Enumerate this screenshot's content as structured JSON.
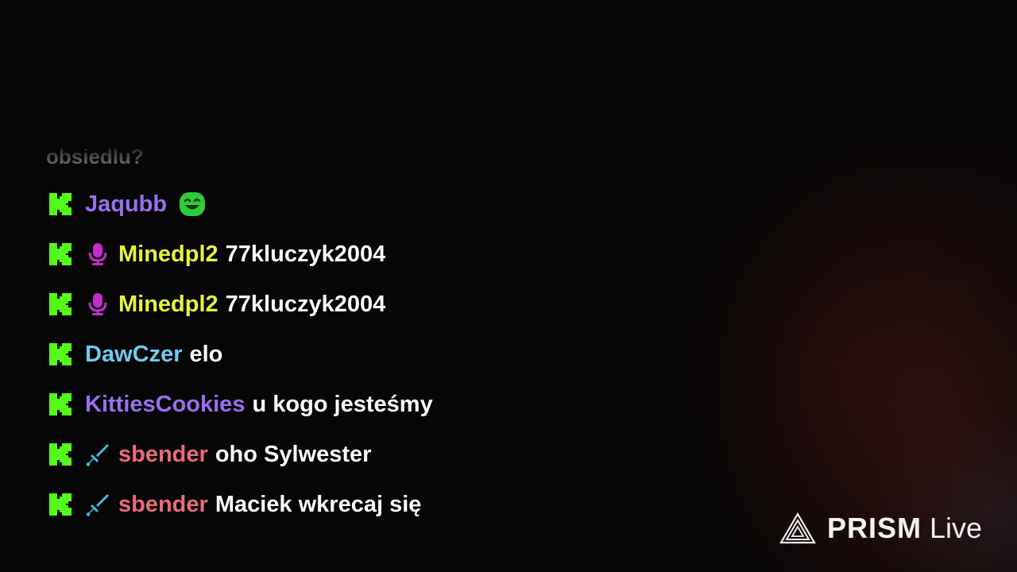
{
  "chat": {
    "cutoff_text": "obsiedlu?",
    "messages": [
      {
        "platform_icon": "kick-logo-icon",
        "badge": null,
        "username": "Jaqubb",
        "user_color": "#9b6ff0",
        "text": "",
        "emote": "grin-emote-icon"
      },
      {
        "platform_icon": "kick-logo-icon",
        "badge": "microphone-icon",
        "badge_color": "#c02fc9",
        "username": "Minedpl2",
        "user_color": "#e5f53a",
        "text": "77kluczyk2004"
      },
      {
        "platform_icon": "kick-logo-icon",
        "badge": "microphone-icon",
        "badge_color": "#c02fc9",
        "username": "Minedpl2",
        "user_color": "#e5f53a",
        "text": "77kluczyk2004"
      },
      {
        "platform_icon": "kick-logo-icon",
        "badge": null,
        "username": "DawCzer",
        "user_color": "#6ecbf0",
        "text": "elo"
      },
      {
        "platform_icon": "kick-logo-icon",
        "badge": null,
        "username": "KittiesCookies",
        "user_color": "#9b6ff0",
        "text": "u kogo jesteśmy"
      },
      {
        "platform_icon": "kick-logo-icon",
        "badge": "sword-icon",
        "badge_color": "#3ec0ec",
        "username": "sbender",
        "user_color": "#ec6b7a",
        "text": "oho Sylwester"
      },
      {
        "platform_icon": "kick-logo-icon",
        "badge": "sword-icon",
        "badge_color": "#3ec0ec",
        "username": "sbender",
        "user_color": "#ec6b7a",
        "text": "Maciek wkrecaj się"
      }
    ]
  },
  "watermark": {
    "brand": "PRISM",
    "suffix": "Live",
    "logo_icon": "prism-triangle-icon"
  },
  "colors": {
    "kick_green": "#53fc18",
    "background": "#060606"
  }
}
